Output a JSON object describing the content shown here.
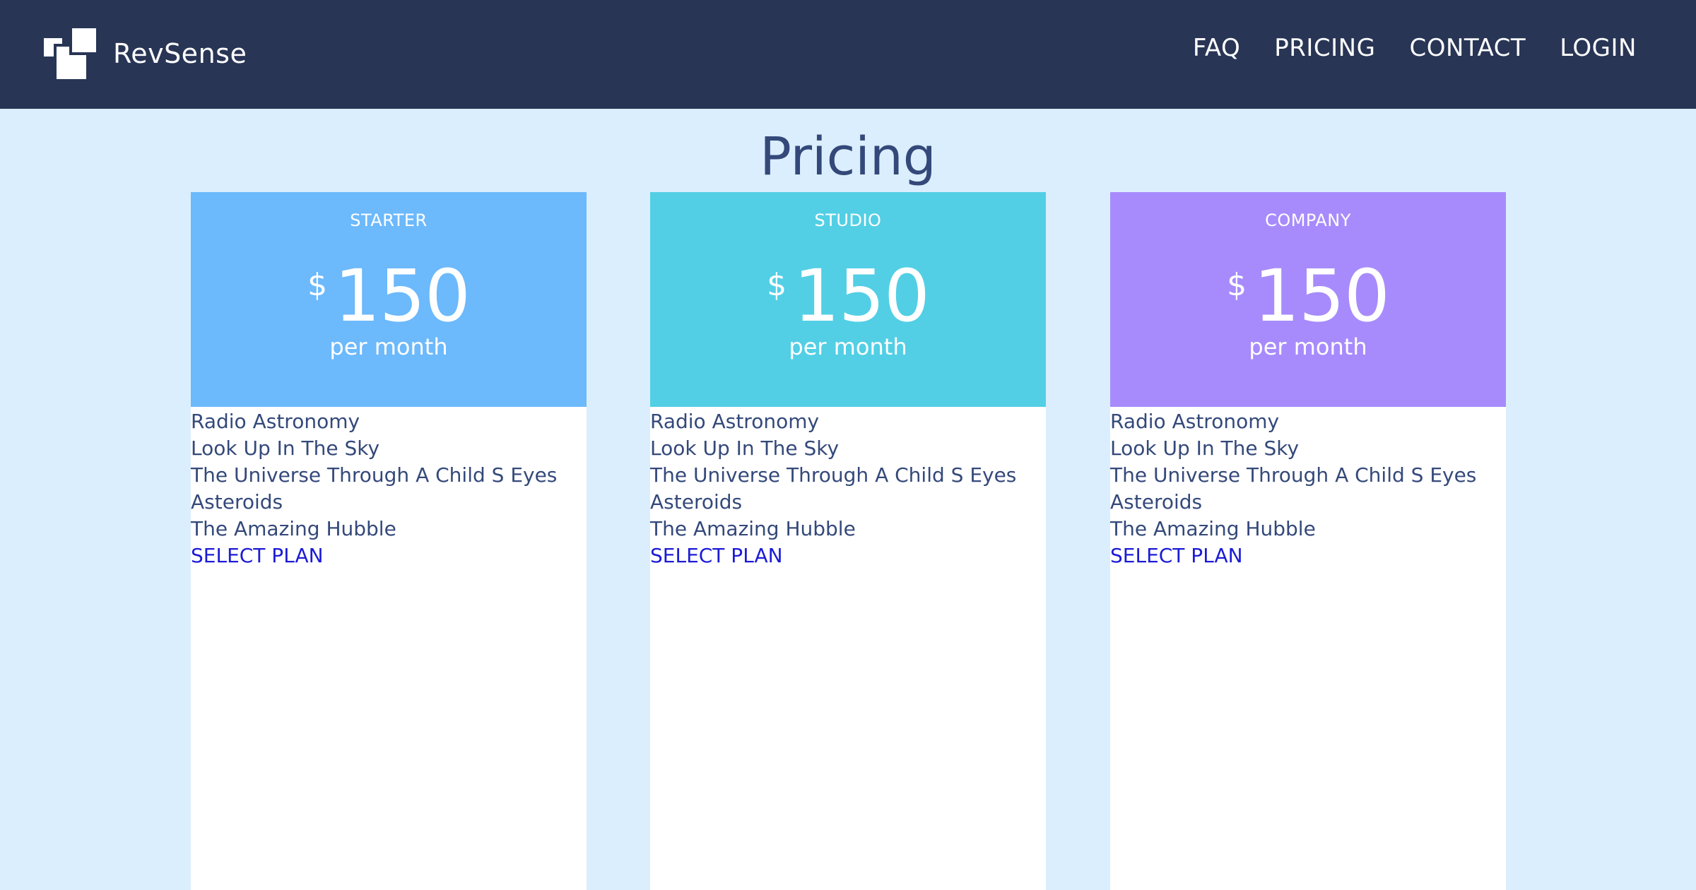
{
  "brand": {
    "name": "RevSense",
    "logo_icon": "stacked-squares-logo"
  },
  "nav": {
    "items": [
      {
        "label": "FAQ"
      },
      {
        "label": "PRICING"
      },
      {
        "label": "CONTACT"
      },
      {
        "label": "LOGIN"
      }
    ]
  },
  "page": {
    "title": "Pricing"
  },
  "plans": [
    {
      "name": "STARTER",
      "currency": "$",
      "price": "150",
      "period": "per month",
      "header_color": "#6cb9fc",
      "features": [
        "Radio Astronomy",
        "Look Up In The Sky",
        "The Universe Through A Child S Eyes",
        "Asteroids",
        "The Amazing Hubble"
      ],
      "cta": "SELECT PLAN"
    },
    {
      "name": "STUDIO",
      "currency": "$",
      "price": "150",
      "period": "per month",
      "header_color": "#52cfe5",
      "features": [
        "Radio Astronomy",
        "Look Up In The Sky",
        "The Universe Through A Child S Eyes",
        "Asteroids",
        "The Amazing Hubble"
      ],
      "cta": "SELECT PLAN"
    },
    {
      "name": "COMPANY",
      "currency": "$",
      "price": "150",
      "period": "per month",
      "header_color": "#a78bfc",
      "features": [
        "Radio Astronomy",
        "Look Up In The Sky",
        "The Universe Through A Child S Eyes",
        "Asteroids",
        "The Amazing Hubble"
      ],
      "cta": "SELECT PLAN"
    }
  ],
  "colors": {
    "navbar_bg": "#283555",
    "page_bg": "#dbeefd",
    "text": "#34497a",
    "link": "#1b1bd6"
  }
}
